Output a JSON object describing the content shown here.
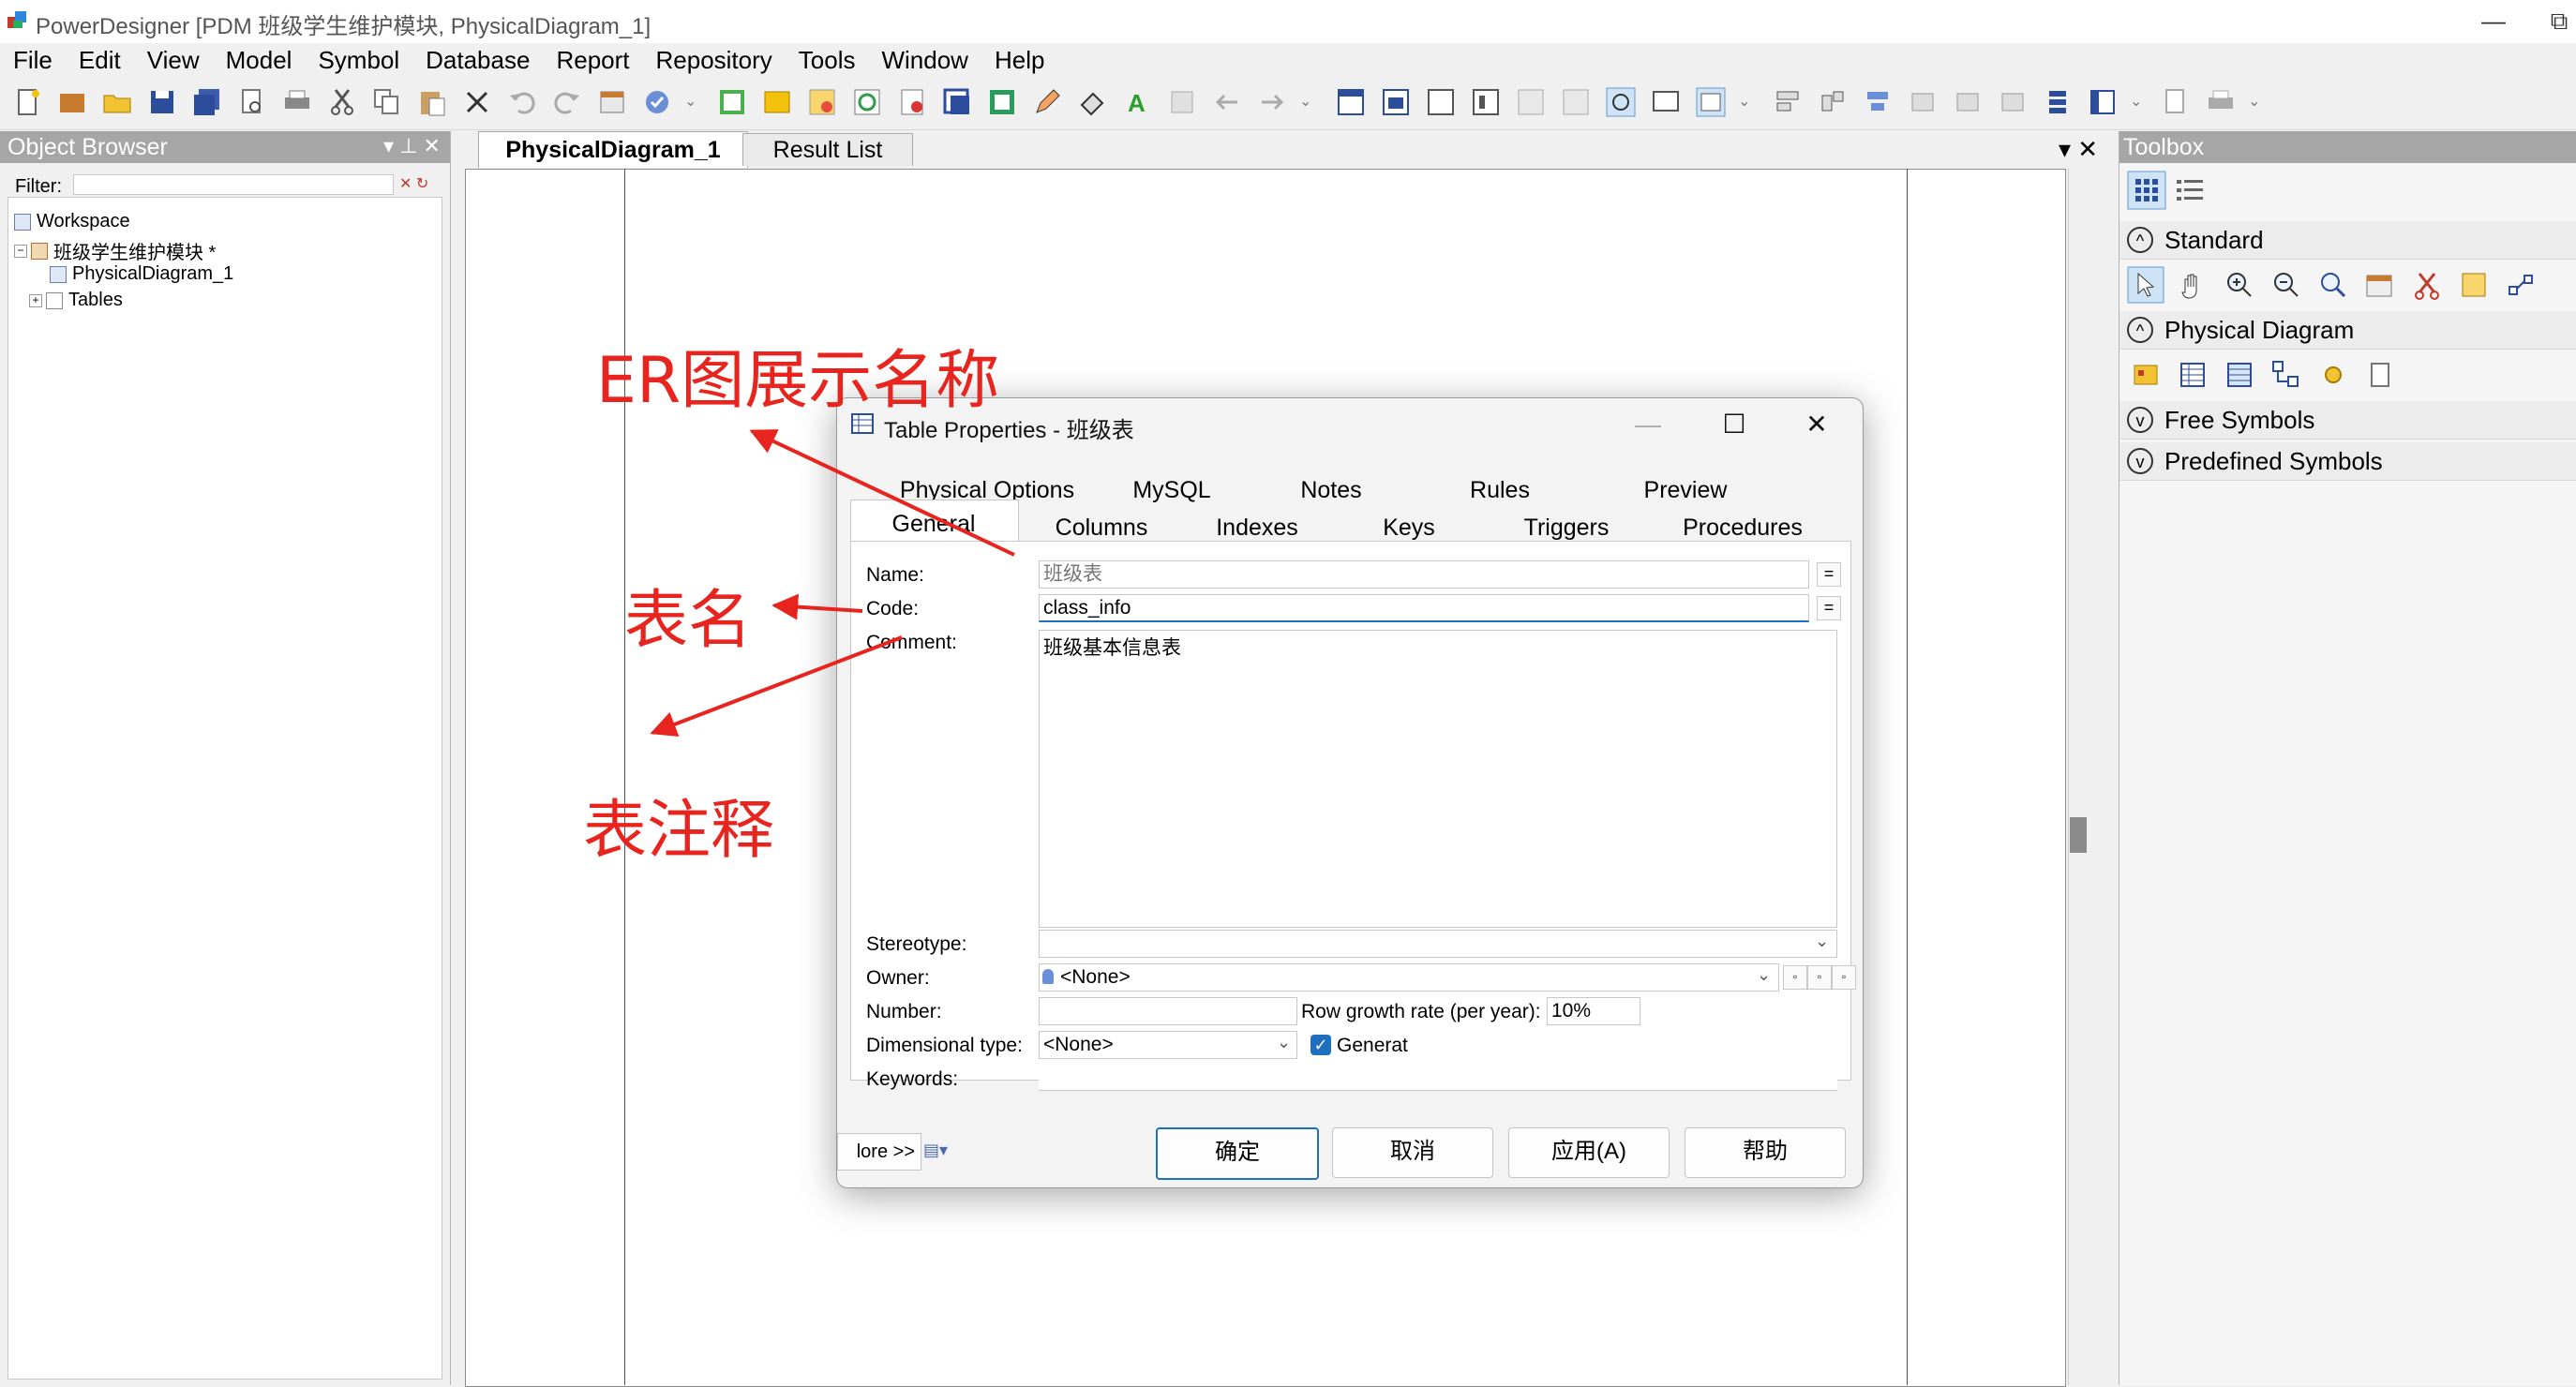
{
  "window": {
    "title": "PowerDesigner [PDM 班级学生维护模块, PhysicalDiagram_1]",
    "controls": [
      "—",
      "⧉"
    ]
  },
  "menu": [
    "File",
    "Edit",
    "View",
    "Model",
    "Symbol",
    "Database",
    "Report",
    "Repository",
    "Tools",
    "Window",
    "Help"
  ],
  "object_browser": {
    "title": "Object Browser",
    "header_buttons": "▾  ⊥  ✕",
    "filter_label": "Filter:",
    "filter_icons": "✕ ↻",
    "tree": [
      {
        "label": "Workspace",
        "expander": ""
      },
      {
        "label": "班级学生维护模块 *",
        "expander": "−"
      },
      {
        "label": "PhysicalDiagram_1",
        "expander": ""
      },
      {
        "label": "Tables",
        "expander": "+"
      }
    ]
  },
  "center": {
    "tabs": [
      "PhysicalDiagram_1",
      "Result List"
    ],
    "controls": "▾ ✕"
  },
  "toolbox": {
    "title": "Toolbox",
    "categories": [
      {
        "label": "Standard",
        "state": "^"
      },
      {
        "label": "Physical Diagram",
        "state": "^"
      },
      {
        "label": "Free Symbols",
        "state": "v"
      },
      {
        "label": "Predefined Symbols",
        "state": "v"
      }
    ]
  },
  "dialog": {
    "title": "Table Properties - 班级表",
    "controls": [
      "—",
      "☐",
      "✕"
    ],
    "tabs_row1": [
      "Physical Options",
      "MySQL",
      "Notes",
      "Rules",
      "Preview"
    ],
    "tabs_row2": [
      "General",
      "Columns",
      "Indexes",
      "Keys",
      "Triggers",
      "Procedures"
    ],
    "active_tab": "General",
    "fields": {
      "name": {
        "label": "Name:",
        "value": "班级表"
      },
      "code": {
        "label": "Code:",
        "value": "class_info"
      },
      "comment": {
        "label": "Comment:",
        "value": "班级基本信息表"
      },
      "stereotype": {
        "label": "Stereotype:",
        "value": ""
      },
      "owner": {
        "label": "Owner:",
        "value": "<None>"
      },
      "number": {
        "label": "Number:",
        "value": ""
      },
      "row_growth": {
        "label": "Row growth rate (per year):",
        "value": "10%"
      },
      "dimensional_type": {
        "label": "Dimensional type:",
        "value": "<None>"
      },
      "generate": {
        "label": "Generat",
        "checked": true
      },
      "keywords": {
        "label": "Keywords:",
        "value": ""
      }
    },
    "more_label": "lore >>",
    "buttons": [
      "确定",
      "取消",
      "应用(A)",
      "帮助"
    ]
  },
  "annotations": {
    "er_name": "ER图展示名称",
    "table_name": "表名",
    "table_comment": "表注释"
  },
  "colors": {
    "annotation": "#e8241e",
    "panel_header": "#a6a6a6",
    "accent": "#1f6fbf"
  }
}
